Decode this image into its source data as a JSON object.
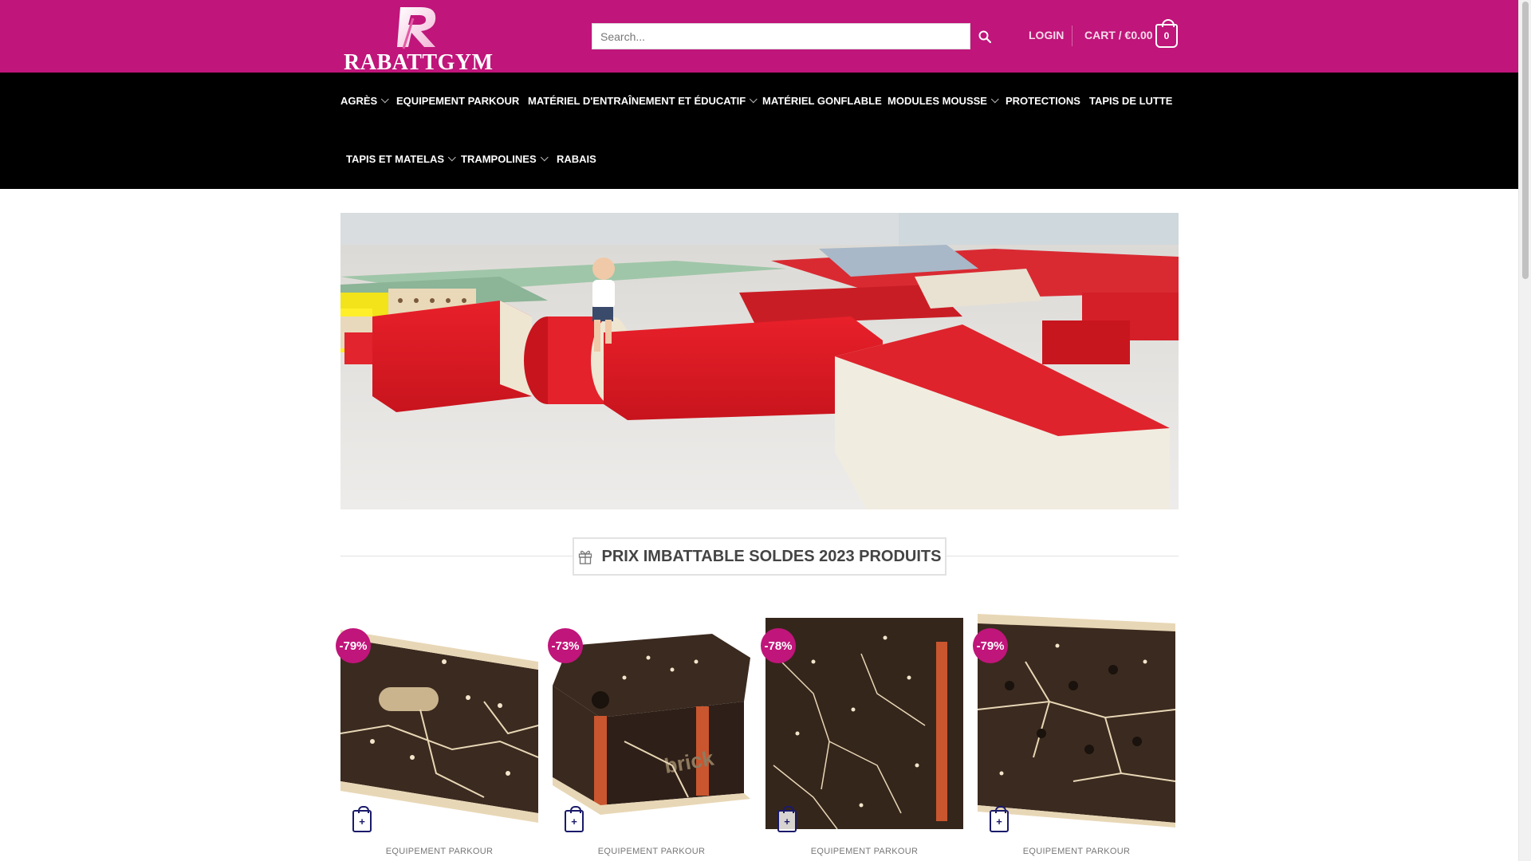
{
  "header": {
    "logo_text": "RABATTGYM",
    "search_placeholder": "Search...",
    "login_label": "LOGIN",
    "cart_label": "CART / €0.00",
    "cart_count": "0",
    "brand_color": "#c0157a"
  },
  "nav": {
    "items": [
      {
        "label": "AGRÈS",
        "has_dropdown": true
      },
      {
        "label": "EQUIPEMENT PARKOUR",
        "has_dropdown": false
      },
      {
        "label": "MATÉRIEL D'ENTRAÎNEMENT ET ÉDUCATIF",
        "has_dropdown": true
      },
      {
        "label": "MATÉRIEL GONFLABLE",
        "has_dropdown": false
      },
      {
        "label": "MODULES MOUSSE",
        "has_dropdown": true
      },
      {
        "label": "PROTECTIONS",
        "has_dropdown": false
      },
      {
        "label": "TAPIS DE LUTTE",
        "has_dropdown": false
      },
      {
        "label": "TAPIS ET MATELAS",
        "has_dropdown": true
      },
      {
        "label": "TRAMPOLINES",
        "has_dropdown": true
      },
      {
        "label": "RABAIS",
        "has_dropdown": false
      }
    ]
  },
  "section": {
    "title": "PRIX IMBATTABLE SOLDES 2023 PRODUITS",
    "icon": "gift-icon"
  },
  "products": [
    {
      "discount": "-79%",
      "category": "EQUIPEMENT PARKOUR"
    },
    {
      "discount": "-73%",
      "category": "EQUIPEMENT PARKOUR"
    },
    {
      "discount": "-78%",
      "category": "EQUIPEMENT PARKOUR"
    },
    {
      "discount": "-79%",
      "category": "EQUIPEMENT PARKOUR"
    }
  ],
  "product_image_text": "brick"
}
